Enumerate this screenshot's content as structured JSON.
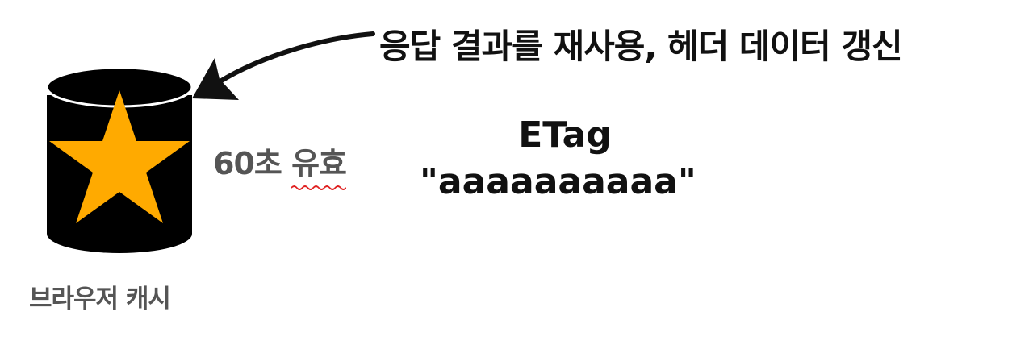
{
  "annotation": {
    "text": "응답 결과를 재사용, 헤더 데이터 갱신"
  },
  "cache": {
    "label": "브라우저 캐시",
    "body_color": "#000000",
    "star_color": "#FFAA00"
  },
  "validity": {
    "seconds": "60초",
    "status": "유효",
    "underline_color": "#E02020"
  },
  "etag": {
    "title": "ETag",
    "value": "\"aaaaaaaaaa\""
  }
}
